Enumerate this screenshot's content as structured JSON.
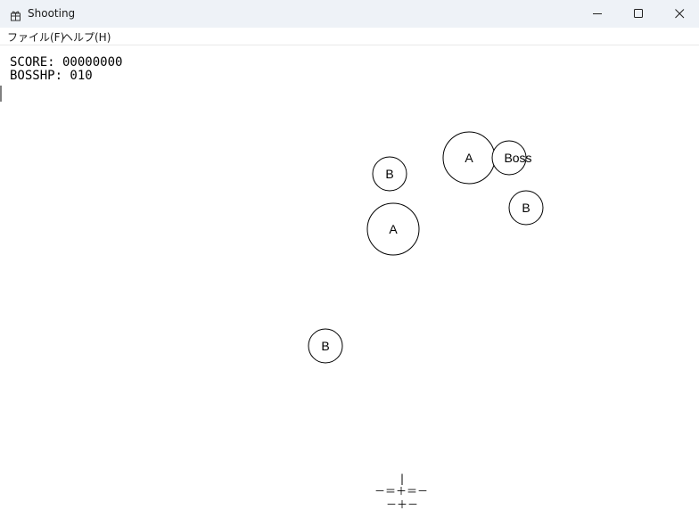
{
  "window": {
    "title": "Shooting",
    "icon": "gift-icon",
    "controls": [
      "minimize-icon",
      "maximize-icon",
      "close-icon"
    ]
  },
  "menu": {
    "file": "ファイル(F)",
    "help": "ヘルプ(H)"
  },
  "hud": {
    "score": "SCORE: 00000000",
    "boss_hp": "BOSSHP: 010"
  },
  "sprites": {
    "boss": "Boss",
    "enemy_a": "A",
    "enemy_b": "B"
  },
  "player": {
    "line1": "|",
    "line2": "－＝＋＝－",
    "line3": "－＋－"
  }
}
